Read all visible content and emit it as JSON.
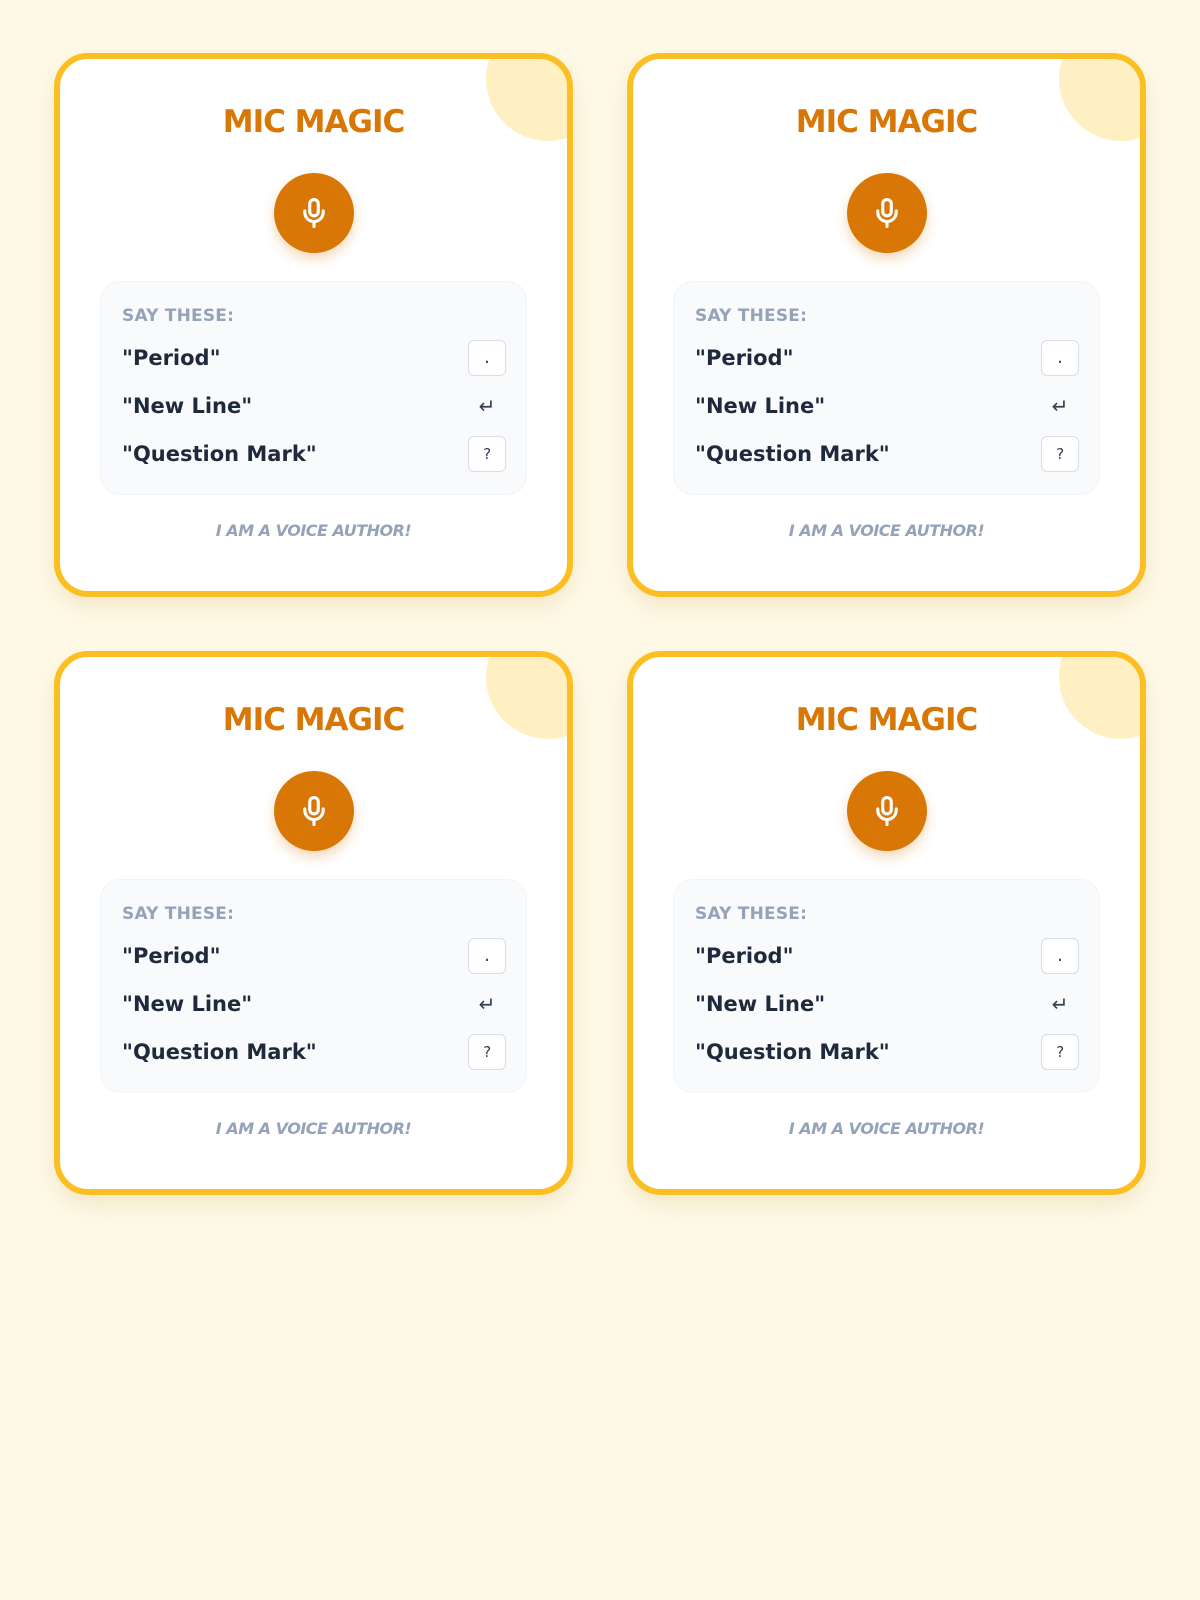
{
  "colors": {
    "page_background": "#fef9e7",
    "card_border": "#fbbf24",
    "accent": "#d97706",
    "muted_text": "#94a3b8",
    "text": "#1e293b",
    "panel_background": "#f8fafc"
  },
  "cards": [
    {
      "title": "MIC MAGIC",
      "mic_icon": "microphone-icon",
      "commands_heading": "SAY THESE:",
      "commands": [
        {
          "phrase": "\"Period\"",
          "symbol": "."
        },
        {
          "phrase": "\"New Line\"",
          "symbol": "↵"
        },
        {
          "phrase": "\"Question Mark\"",
          "symbol": "?"
        }
      ],
      "tagline": "I AM A VOICE AUTHOR!"
    },
    {
      "title": "MIC MAGIC",
      "mic_icon": "microphone-icon",
      "commands_heading": "SAY THESE:",
      "commands": [
        {
          "phrase": "\"Period\"",
          "symbol": "."
        },
        {
          "phrase": "\"New Line\"",
          "symbol": "↵"
        },
        {
          "phrase": "\"Question Mark\"",
          "symbol": "?"
        }
      ],
      "tagline": "I AM A VOICE AUTHOR!"
    },
    {
      "title": "MIC MAGIC",
      "mic_icon": "microphone-icon",
      "commands_heading": "SAY THESE:",
      "commands": [
        {
          "phrase": "\"Period\"",
          "symbol": "."
        },
        {
          "phrase": "\"New Line\"",
          "symbol": "↵"
        },
        {
          "phrase": "\"Question Mark\"",
          "symbol": "?"
        }
      ],
      "tagline": "I AM A VOICE AUTHOR!"
    },
    {
      "title": "MIC MAGIC",
      "mic_icon": "microphone-icon",
      "commands_heading": "SAY THESE:",
      "commands": [
        {
          "phrase": "\"Period\"",
          "symbol": "."
        },
        {
          "phrase": "\"New Line\"",
          "symbol": "↵"
        },
        {
          "phrase": "\"Question Mark\"",
          "symbol": "?"
        }
      ],
      "tagline": "I AM A VOICE AUTHOR!"
    }
  ]
}
